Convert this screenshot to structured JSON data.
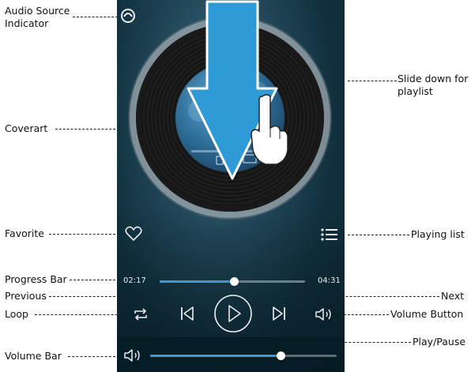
{
  "annotations": {
    "audio_source": "Audio Source\nIndicator",
    "coverart": "Coverart",
    "favorite": "Favorite",
    "progress_bar": "Progress Bar",
    "previous": "Previous",
    "loop": "Loop",
    "volume_bar": "Volume Bar",
    "slide_down": "Slide down for\nplaylist",
    "playing_list": "Playing list",
    "next": "Next",
    "volume_button": "Volume Button",
    "play_pause": "Play/Pause"
  },
  "player": {
    "elapsed": "02:17",
    "total": "04:31",
    "progress_fraction": 0.51,
    "volume_fraction": 0.7
  },
  "icons": {
    "audio_source": "headphones-icon",
    "favorite": "heart-icon",
    "playlist": "list-icon",
    "loop": "repeat-icon",
    "previous": "skip-back-icon",
    "play": "play-icon",
    "next": "skip-forward-icon",
    "volume": "speaker-icon",
    "gesture": "hand-pointer-icon",
    "arrow": "down-arrow-icon"
  },
  "colors": {
    "accent": "#3b9ad6",
    "arrow": "#2e9bd6"
  }
}
